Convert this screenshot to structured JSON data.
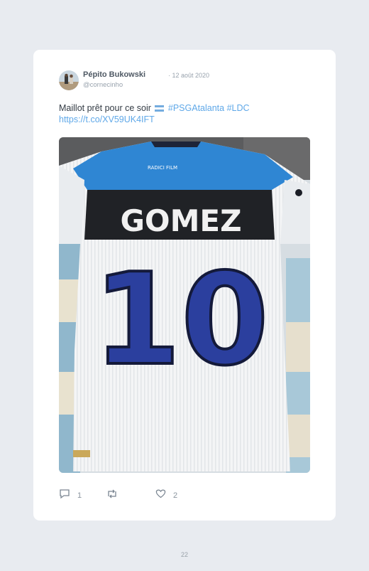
{
  "tweet": {
    "author_name": "Pépito Bukowski",
    "date": "· 12 août 2020",
    "handle": "@cornecinho",
    "text_main": "Maillot prêt pour ce soir",
    "flag_icon": "argentina-flag-icon",
    "hashtag_1": "#PSGAtalanta",
    "hashtag_2": "#LDC",
    "link": "https://t.co/XV59UK4IFT",
    "image": {
      "jersey_name": "GOMEZ",
      "jersey_number": "10",
      "sponsor_text": "RADICI FILM"
    },
    "actions": {
      "reply_icon": "reply-icon",
      "reply_count": "1",
      "retweet_icon": "retweet-icon",
      "like_icon": "heart-icon",
      "like_count": "2"
    }
  },
  "page": {
    "number": "22"
  },
  "colors": {
    "background": "#e8ebf0",
    "card": "#ffffff",
    "link": "#5fa8e8",
    "jersey_blue": "#2f86d3",
    "jersey_number": "#2b3f9e"
  }
}
